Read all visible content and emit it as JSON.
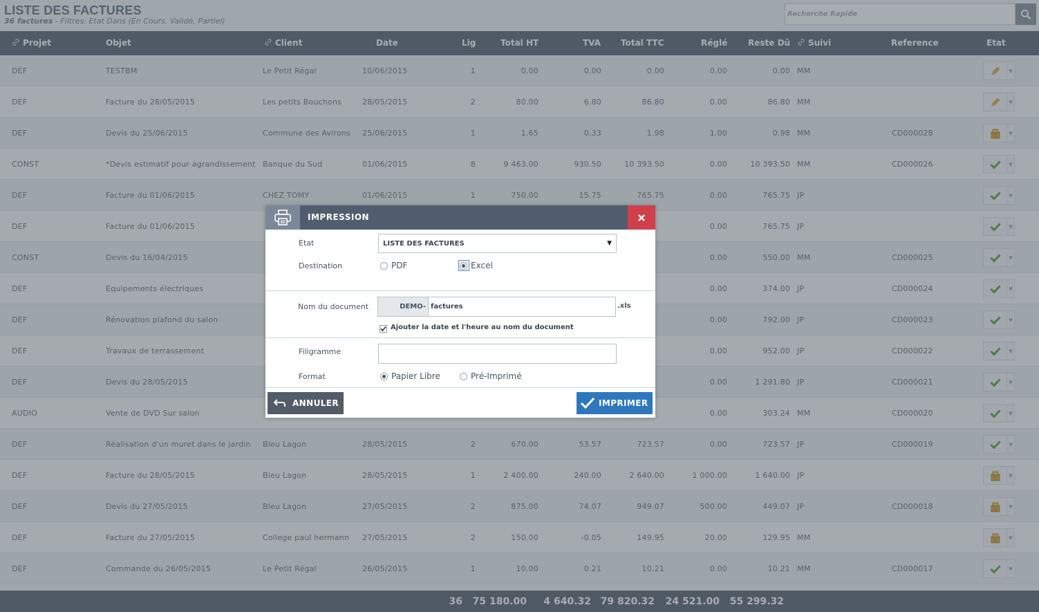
{
  "header": {
    "title": "LISTE DES FACTURES",
    "count_label": "36 factures",
    "filters_label": " - Filtres: Etat Dans (En Cours, Validé, Partiel)",
    "search_placeholder": "Recherche Rapide"
  },
  "columns": {
    "projet": "Projet",
    "objet": "Objet",
    "client": "Client",
    "date": "Date",
    "lig": "Lig",
    "total_ht": "Total HT",
    "tva": "TVA",
    "total_ttc": "Total TTC",
    "regle": "Réglé",
    "reste_du": "Reste Dû",
    "suivi": "Suivi",
    "reference": "Reference",
    "etat": "Etat"
  },
  "rows": [
    {
      "projet": "DEF",
      "objet": "TESTBM",
      "client": "Le Petit Régal",
      "date": "10/06/2015",
      "lig": "1",
      "ht": "0.00",
      "tva": "0.00",
      "ttc": "0.00",
      "regle": "0.00",
      "reste": "0.00",
      "suivi": "MM",
      "ref": "",
      "state": "pencil"
    },
    {
      "projet": "DEF",
      "objet": "Facture du 28/05/2015",
      "client": "Les petits Bouchons",
      "date": "28/05/2015",
      "lig": "2",
      "ht": "80.00",
      "tva": "6.80",
      "ttc": "86.80",
      "regle": "0.00",
      "reste": "86.80",
      "suivi": "MM",
      "ref": "",
      "state": "pencil"
    },
    {
      "projet": "DEF",
      "objet": "Devis du 25/06/2015",
      "client": "Commune des Avirons",
      "date": "25/06/2015",
      "lig": "1",
      "ht": "1.65",
      "tva": "0.33",
      "ttc": "1.98",
      "regle": "1.00",
      "reste": "0.98",
      "suivi": "MM",
      "ref": "CD000028",
      "state": "partial"
    },
    {
      "projet": "CONST",
      "objet": "*Devis estimatif pour agrandissement",
      "client": "Banque du Sud",
      "date": "01/06/2015",
      "lig": "8",
      "ht": "9 463.00",
      "tva": "930.50",
      "ttc": "10 393.50",
      "regle": "0.00",
      "reste": "10 393.50",
      "suivi": "MM",
      "ref": "CD000026",
      "state": "check"
    },
    {
      "projet": "DEF",
      "objet": "Facture du 01/06/2015",
      "client": "CHEZ TOMY",
      "date": "01/06/2015",
      "lig": "1",
      "ht": "750.00",
      "tva": "15.75",
      "ttc": "765.75",
      "regle": "0.00",
      "reste": "765.75",
      "suivi": "JP",
      "ref": "",
      "state": "check"
    },
    {
      "projet": "DEF",
      "objet": "Facture du 01/06/2015",
      "client": "",
      "date": "",
      "lig": "",
      "ht": "",
      "tva": "",
      "ttc": "",
      "regle": "0.00",
      "reste": "765.75",
      "suivi": "JP",
      "ref": "",
      "state": "check"
    },
    {
      "projet": "CONST",
      "objet": "Devis du 16/04/2015",
      "client": "",
      "date": "",
      "lig": "",
      "ht": "",
      "tva": "",
      "ttc": "",
      "regle": "0.00",
      "reste": "550.00",
      "suivi": "MM",
      "ref": "CD000025",
      "state": "check"
    },
    {
      "projet": "DEF",
      "objet": "Equipements électriques",
      "client": "",
      "date": "",
      "lig": "",
      "ht": "",
      "tva": "",
      "ttc": "",
      "regle": "0.00",
      "reste": "374.00",
      "suivi": "JP",
      "ref": "CD000024",
      "state": "check"
    },
    {
      "projet": "DEF",
      "objet": "Rénovation plafond du salon",
      "client": "",
      "date": "",
      "lig": "",
      "ht": "",
      "tva": "",
      "ttc": "",
      "regle": "0.00",
      "reste": "792.00",
      "suivi": "JP",
      "ref": "CD000023",
      "state": "check"
    },
    {
      "projet": "DEF",
      "objet": "Travaux de terrassement",
      "client": "",
      "date": "",
      "lig": "",
      "ht": "",
      "tva": "",
      "ttc": "",
      "regle": "0.00",
      "reste": "952.00",
      "suivi": "JP",
      "ref": "CD000022",
      "state": "check"
    },
    {
      "projet": "DEF",
      "objet": "Devis du 28/05/2015",
      "client": "",
      "date": "",
      "lig": "",
      "ht": "",
      "tva": "",
      "ttc": "",
      "regle": "0.00",
      "reste": "1 291.80",
      "suivi": "JP",
      "ref": "CD000021",
      "state": "check"
    },
    {
      "projet": "AUDIO",
      "objet": "Vente de DVD Sur salon",
      "client": "",
      "date": "",
      "lig": "",
      "ht": "",
      "tva": "",
      "ttc": "",
      "regle": "0.00",
      "reste": "303.24",
      "suivi": "MM",
      "ref": "CD000020",
      "state": "check"
    },
    {
      "projet": "DEF",
      "objet": "Réalisation d'un muret dans le jardin",
      "client": "Bleu Lagon",
      "date": "28/05/2015",
      "lig": "2",
      "ht": "670.00",
      "tva": "53.57",
      "ttc": "723.57",
      "regle": "0.00",
      "reste": "723.57",
      "suivi": "JP",
      "ref": "CD000019",
      "state": "check"
    },
    {
      "projet": "DEF",
      "objet": "Facture du 28/05/2015",
      "client": "Bleu Lagon",
      "date": "28/05/2015",
      "lig": "1",
      "ht": "2 400.00",
      "tva": "240.00",
      "ttc": "2 640.00",
      "regle": "1 000.00",
      "reste": "1 640.00",
      "suivi": "JP",
      "ref": "",
      "state": "partial"
    },
    {
      "projet": "DEF",
      "objet": "Devis du 27/05/2015",
      "client": "Bleu Lagon",
      "date": "27/05/2015",
      "lig": "2",
      "ht": "875.00",
      "tva": "74.07",
      "ttc": "949.07",
      "regle": "500.00",
      "reste": "449.07",
      "suivi": "JP",
      "ref": "CD000018",
      "state": "partial"
    },
    {
      "projet": "DEF",
      "objet": "Facture du 27/05/2015",
      "client": "College paul hermann",
      "date": "27/05/2015",
      "lig": "2",
      "ht": "150.00",
      "tva": "-0.05",
      "ttc": "149.95",
      "regle": "20.00",
      "reste": "129.95",
      "suivi": "MM",
      "ref": "",
      "state": "partial"
    },
    {
      "projet": "DEF",
      "objet": "Commande du 26/05/2015",
      "client": "Le Petit Régal",
      "date": "26/05/2015",
      "lig": "1",
      "ht": "10.00",
      "tva": "0.21",
      "ttc": "10.21",
      "regle": "0.00",
      "reste": "10.21",
      "suivi": "MM",
      "ref": "CD000017",
      "state": "check"
    }
  ],
  "totals": {
    "lig": "36",
    "ht": "75 180.00",
    "tva": "4 640.32",
    "ttc": "79 820.32",
    "regle": "24 521.00",
    "reste": "55 299.32"
  },
  "modal": {
    "title": "IMPRESSION",
    "etat_label": "Etat",
    "etat_value": "LISTE DES FACTURES",
    "destination_label": "Destination",
    "dest_pdf": "PDF",
    "dest_excel": "Excel",
    "dest_selected": "Excel",
    "nom_label": "Nom du document",
    "nom_prefix": "DEMO-",
    "nom_value": "factures",
    "nom_ext": ".xls",
    "add_date_label": "Ajouter la date et l'heure au nom du document",
    "add_date_checked": true,
    "filigrane_label": "Filigramme",
    "filigrane_value": "",
    "format_label": "Format",
    "format_libre": "Papier Libre",
    "format_preimprime": "Pré-Imprimé",
    "format_selected": "Papier Libre",
    "cancel_label": "ANNULER",
    "print_label": "IMPRIMER"
  },
  "colors": {
    "header_bar": "#606b78",
    "modal_header": "#515d6c",
    "close_red": "#d0404a",
    "print_blue": "#2f77bc",
    "check_green": "#5fa83d"
  }
}
